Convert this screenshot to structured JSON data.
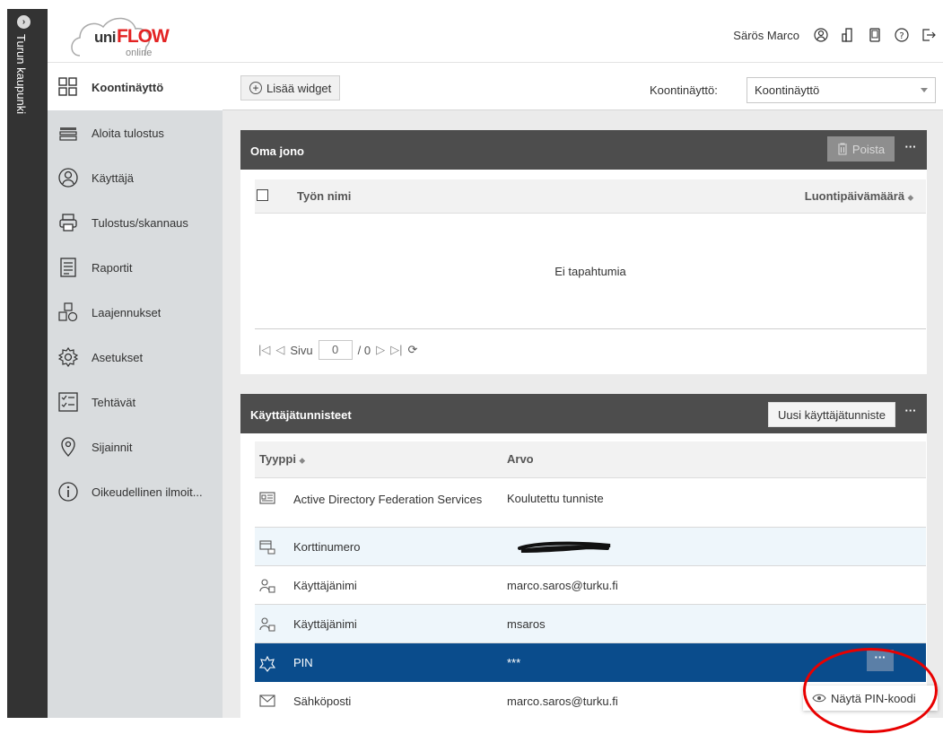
{
  "rail": {
    "label": "Turun kaupunki",
    "toggle_icon": "chevron-right-icon"
  },
  "header": {
    "logo": {
      "uni": "uni",
      "flow": "FLOW",
      "online": "online"
    },
    "user_name": "Särös Marco",
    "icons": [
      "user-circle-icon",
      "device-icon",
      "phone-icon",
      "help-icon",
      "logout-icon"
    ]
  },
  "sidebar": {
    "items": [
      {
        "label": "Koontinäyttö",
        "icon": "dashboard-icon",
        "active": true
      },
      {
        "label": "Aloita tulostus",
        "icon": "print-tray-icon"
      },
      {
        "label": "Käyttäjä",
        "icon": "user-icon"
      },
      {
        "label": "Tulostus/skannaus",
        "icon": "printer-icon"
      },
      {
        "label": "Raportit",
        "icon": "report-icon"
      },
      {
        "label": "Laajennukset",
        "icon": "extensions-icon"
      },
      {
        "label": "Asetukset",
        "icon": "gear-icon"
      },
      {
        "label": "Tehtävät",
        "icon": "tasks-icon"
      },
      {
        "label": "Sijainnit",
        "icon": "location-icon"
      },
      {
        "label": "Oikeudellinen ilmoit...",
        "icon": "info-icon"
      }
    ]
  },
  "toolbar": {
    "add_widget": "Lisää widget",
    "dashboard_label": "Koontinäyttö:",
    "dashboard_value": "Koontinäyttö"
  },
  "queue": {
    "title": "Oma jono",
    "delete_label": "Poista",
    "more": "···",
    "col_name": "Työn nimi",
    "col_date": "Luontipäivämäärä",
    "empty_text": "Ei tapahtumia",
    "pager": {
      "label": "Sivu",
      "page": "0",
      "total": "/ 0"
    }
  },
  "identifiers": {
    "title": "Käyttäjätunnisteet",
    "new_button": "Uusi käyttäjätunniste",
    "more": "···",
    "col_type": "Tyyppi",
    "col_value": "Arvo",
    "rows": [
      {
        "type": "Active Directory Federation Services",
        "value": "Koulutettu tunniste",
        "icon": "id-card-icon"
      },
      {
        "type": "Korttinumero",
        "value": "",
        "icon": "card-lock-icon"
      },
      {
        "type": "Käyttäjänimi",
        "value": "marco.saros@turku.fi",
        "icon": "user-lock-icon"
      },
      {
        "type": "Käyttäjänimi",
        "value": "msaros",
        "icon": "user-lock-icon"
      },
      {
        "type": "PIN",
        "value": "***",
        "icon": "pin-icon",
        "selected": true
      },
      {
        "type": "Sähköposti",
        "value": "marco.saros@turku.fi",
        "icon": "envelope-icon"
      }
    ],
    "context_menu": {
      "label": "Näytä PIN-koodi",
      "icon": "eye-icon"
    }
  },
  "colors": {
    "selected_row": "#0a4c8c",
    "panel_header": "#4d4d4d",
    "annotation": "#e80000"
  }
}
